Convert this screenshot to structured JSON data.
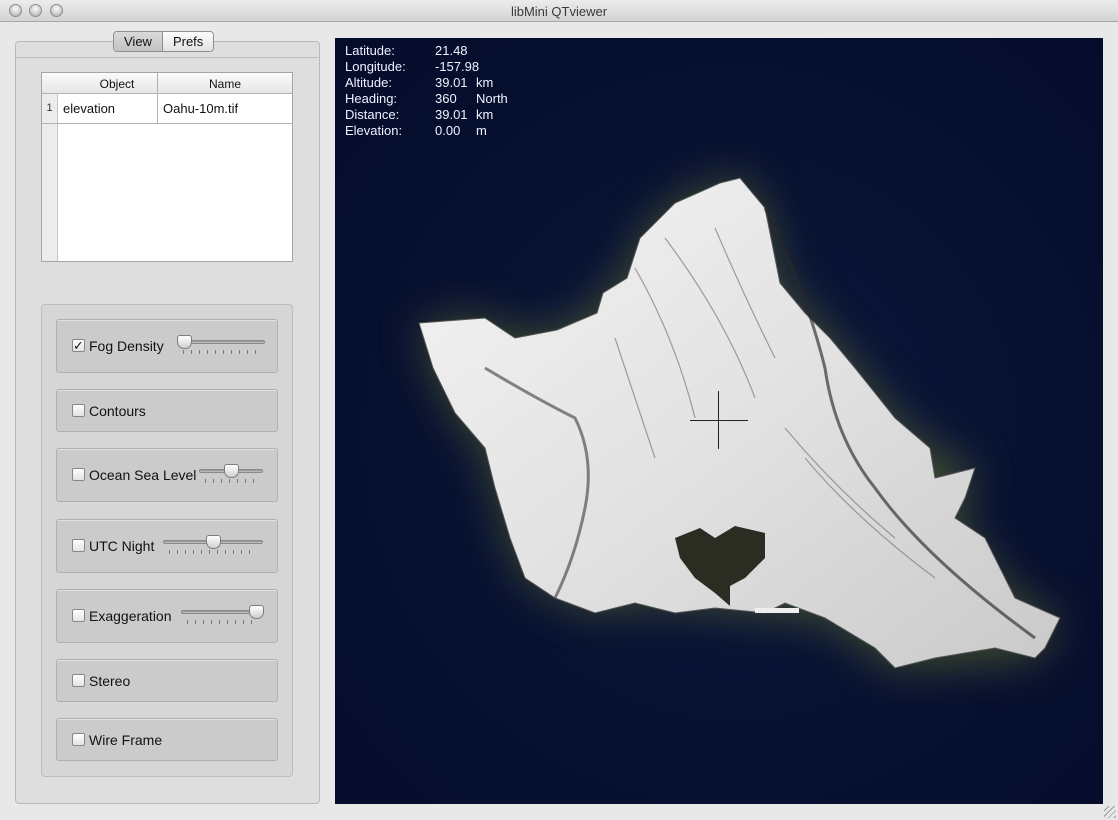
{
  "window": {
    "title": "libMini QTviewer"
  },
  "tabs": [
    {
      "label": "View"
    },
    {
      "label": "Prefs"
    }
  ],
  "object_table": {
    "columns": [
      "Object",
      "Name"
    ],
    "rows": [
      {
        "index": "1",
        "object": "elevation",
        "name": "Oahu-10m.tif"
      }
    ]
  },
  "options": {
    "fog_density": {
      "label": "Fog Density",
      "checked": true,
      "check_glyph": "✓",
      "slider_level": 0.0
    },
    "contours": {
      "label": "Contours",
      "checked": false
    },
    "ocean_sea_level": {
      "label": "Ocean Sea Level",
      "checked": false,
      "slider_level": 0.5
    },
    "utc_night": {
      "label": "UTC Night",
      "checked": false,
      "slider_level": 0.5
    },
    "exaggeration": {
      "label": "Exaggeration",
      "checked": false,
      "slider_level": 1.0
    },
    "stereo": {
      "label": "Stereo",
      "checked": false
    },
    "wire_frame": {
      "label": "Wire Frame",
      "checked": false
    }
  },
  "readout": {
    "latitude": {
      "label": "Latitude:",
      "value": "21.48",
      "unit": ""
    },
    "longitude": {
      "label": "Longitude:",
      "value": "-157.98",
      "unit": ""
    },
    "altitude": {
      "label": "Altitude:",
      "value": "39.01",
      "unit": "km"
    },
    "heading": {
      "label": "Heading:",
      "value": "360",
      "unit": "North"
    },
    "distance": {
      "label": "Distance:",
      "value": "39.01",
      "unit": "km"
    },
    "elevation": {
      "label": "Elevation:",
      "value": "0.00",
      "unit": "m"
    }
  },
  "colors": {
    "ocean": "#081233",
    "island_glow": "#6f7a2a",
    "terrain": "#e9e9e9"
  }
}
